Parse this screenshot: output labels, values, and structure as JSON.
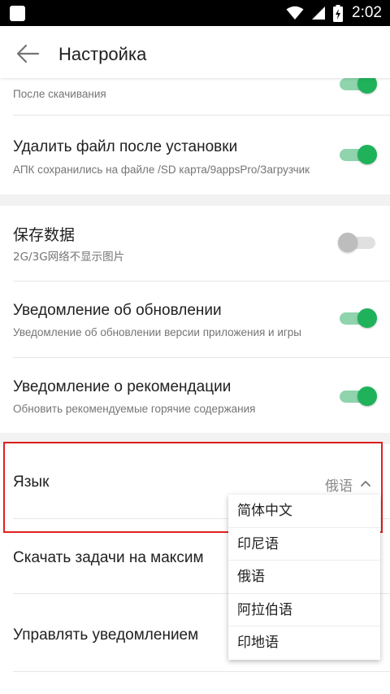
{
  "status_bar": {
    "time": "2:02"
  },
  "app_bar": {
    "title": "Настройка"
  },
  "settings": {
    "after_download": {
      "subtitle": "После скачивания",
      "enabled": true
    },
    "delete_after_install": {
      "title": "Удалить файл после установки",
      "subtitle": "АПК сохранились на файле /SD карта/9appsPro/Загрузчик",
      "enabled": true
    },
    "save_data": {
      "title": "保存数据",
      "subtitle": "2G/3G网络不显示图片",
      "enabled": false
    },
    "update_notification": {
      "title": "Уведомление об обновлении",
      "subtitle": "Уведомление об обновлении версии приложения и игры",
      "enabled": true
    },
    "recommendation_notification": {
      "title": "Уведомление о рекомендации",
      "subtitle": "Обновить рекомендуемые горячие содержания",
      "enabled": true
    },
    "language": {
      "title": "Язык",
      "value": "俄语",
      "options": [
        "简体中文",
        "印尼语",
        "俄语",
        "阿拉伯语",
        "印地语"
      ]
    },
    "max_download_tasks": {
      "title": "Скачать задачи на максим"
    },
    "manage_notifications": {
      "title": "Управлять уведомлением"
    }
  },
  "colors": {
    "accent": "#1fb25a",
    "highlight": "#e02020"
  }
}
